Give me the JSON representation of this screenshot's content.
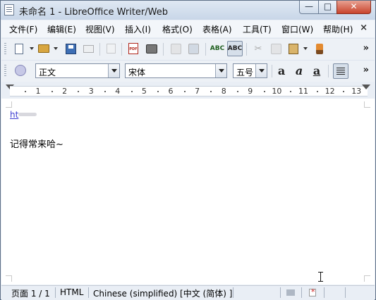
{
  "window": {
    "title": "未命名 1 - LibreOffice Writer/Web",
    "controls": {
      "minimize": "—",
      "maximize": "□",
      "close": "✕"
    }
  },
  "menubar": {
    "items": [
      {
        "label": "文件(F)"
      },
      {
        "label": "编辑(E)"
      },
      {
        "label": "视图(V)"
      },
      {
        "label": "插入(I)"
      },
      {
        "label": "格式(O)"
      },
      {
        "label": "表格(A)"
      },
      {
        "label": "工具(T)"
      },
      {
        "label": "窗口(W)"
      },
      {
        "label": "帮助(H)"
      }
    ],
    "close_glyph": "×"
  },
  "toolbar_standard": {
    "icons": [
      "new-document-icon",
      "open-folder-icon",
      "save-icon",
      "email-icon",
      "edit-file-icon",
      "export-pdf-icon",
      "print-icon",
      "page-preview-icon",
      "html-source-icon",
      "spellcheck-icon",
      "auto-spellcheck-icon",
      "cut-icon",
      "copy-icon",
      "paste-icon",
      "clone-formatting-icon"
    ],
    "pdf_label": "PDF",
    "spell_label": "ABC",
    "auto_spell_label": "ABC",
    "more_glyph": "»"
  },
  "toolbar_formatting": {
    "paragraph_style": "正文",
    "font_name": "宋体",
    "font_size": "五号",
    "bold_glyph": "a",
    "italic_glyph": "a",
    "underline_glyph": "a",
    "more_glyph": "»"
  },
  "ruler": {
    "numbers": [
      "1",
      "2",
      "3",
      "4",
      "5",
      "6",
      "7",
      "8",
      "9",
      "10",
      "11",
      "12",
      "13"
    ]
  },
  "document": {
    "link_text": "ht",
    "body_text": "记得常来哈~"
  },
  "statusbar": {
    "page": "页面 1 / 1",
    "mode": "HTML",
    "language": "Chinese (simplified) [中文 (简体) ]"
  },
  "colors": {
    "frame": "#5d6f86",
    "close_button": "#c9442c",
    "link": "#3a3ad0"
  }
}
